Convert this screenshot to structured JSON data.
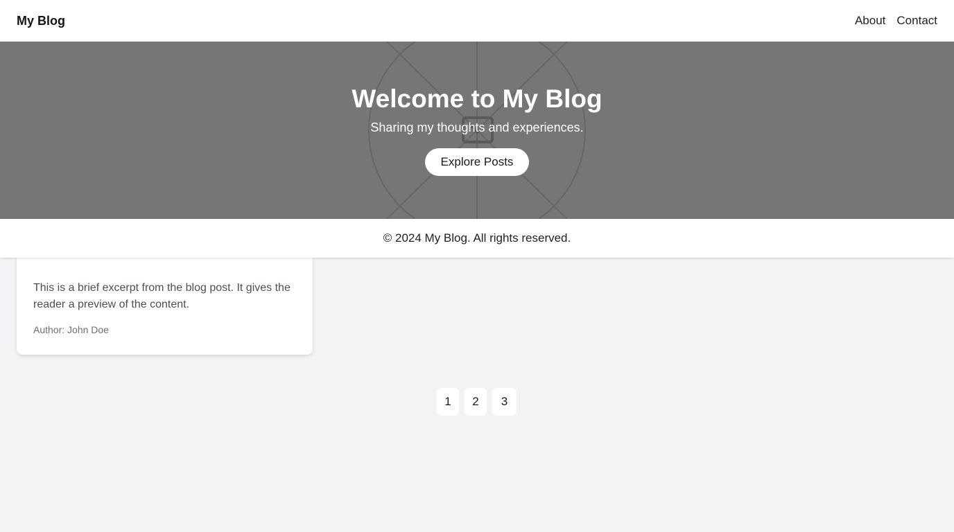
{
  "header": {
    "brand": "My Blog",
    "nav": [
      {
        "label": "About"
      },
      {
        "label": "Contact"
      }
    ]
  },
  "hero": {
    "title": "Welcome to My Blog",
    "subtitle": "Sharing my thoughts and experiences.",
    "button_label": "Explore Posts"
  },
  "footer": {
    "text": "© 2024 My Blog. All rights reserved."
  },
  "posts": [
    {
      "excerpt": "This is a brief excerpt from the blog post. It gives the reader a preview of the content.",
      "author": "Author: John Doe"
    }
  ],
  "pagination": {
    "pages": [
      "1",
      "2",
      "3"
    ]
  },
  "colors": {
    "hero_background": "#767676",
    "page_background": "#f2f3f5"
  }
}
